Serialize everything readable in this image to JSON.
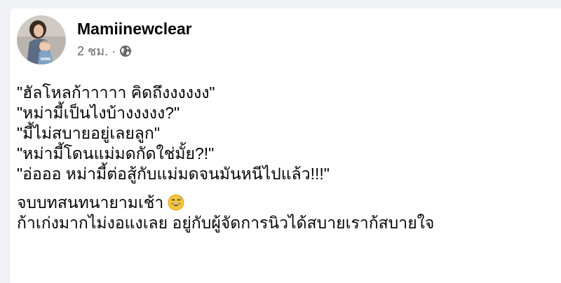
{
  "post": {
    "author": "Mamiinewclear",
    "time": "2 ชม.",
    "separator": "·",
    "privacy_icon": "globe-icon",
    "lines": [
      "\"ฮัลโหลก้าาาาา คิดถึงงงงงง\"",
      "\"หม่ามี้เป็นไงบ้างงงงง?\"",
      "\"มี้ไม่สบายอยู่เลยลูก\"",
      "\"หม่ามี้โดนแม่มดกัดใช่มั้ย?!\"",
      "\"อ่อออ หม่ามี้ต่อสู้กับแม่มดจนมันหนีไปแล้ว!!!\""
    ],
    "closing_line_1": "จบบทสนทนายามเช้า",
    "closing_emoji": "grinning-sweat-emoji",
    "closing_line_2": "ก้าเก่งมากไม่งอแงเลย อยู่กับผู้จัดการนิวได้สบายเราก้สบายใจ"
  },
  "colors": {
    "background": "#f0f2f5",
    "card": "#ffffff",
    "text": "#050505",
    "secondary_text": "#65676b"
  }
}
